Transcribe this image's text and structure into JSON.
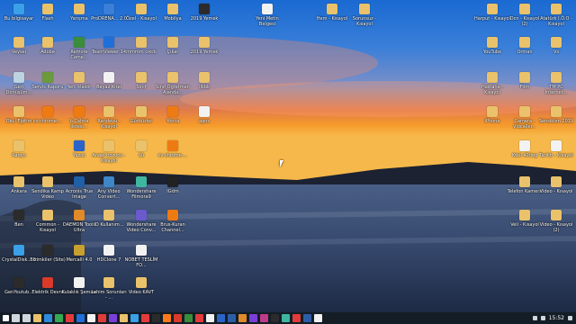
{
  "desktop": {
    "icons": [
      {
        "label": "Bu bilgisayar",
        "color": "#3aa0e8"
      },
      {
        "label": "Flash",
        "color": "#e9c26b"
      },
      {
        "label": "Yarışma",
        "color": "#e9c26b"
      },
      {
        "label": "ProDRENA... 2.0",
        "color": "#3b7fd9"
      },
      {
        "label": "Özel - Kısayol",
        "color": "#e9c26b"
      },
      {
        "label": "Mobilya",
        "color": "#e9c26b"
      },
      {
        "label": "2019 Yemek",
        "color": "#2b2b2b"
      },
      {
        "label": "Yeni Metin Belgesi",
        "color": "#f2f2f2"
      },
      {
        "label": "Hem - Kısayol",
        "color": "#e9c26b"
      },
      {
        "label": "Sorunsuz - Kısayol",
        "color": "#e9c26b"
      },
      {
        "label": "Harput - Kısayol",
        "color": "#e9c26b"
      },
      {
        "label": "Dcn - Kısayol (2)",
        "color": "#e9c26b"
      },
      {
        "label": "Atatürk İ.Ö.O - Kısayol",
        "color": "#e9c26b"
      },
      {
        "label": "Veysel",
        "color": "#e9c26b"
      },
      {
        "label": "Adobe",
        "color": "#e9c26b"
      },
      {
        "label": "Remote Came...",
        "color": "#3a8d3a"
      },
      {
        "label": "TeamViewer 14",
        "color": "#1e6fd9"
      },
      {
        "label": "mmmm cıkck",
        "color": "#e9c26b"
      },
      {
        "label": "Çıkar",
        "color": "#e9c26b"
      },
      {
        "label": "2019 Yemek",
        "color": "#e9c26b"
      },
      {
        "label": "YouTube",
        "color": "#e9c26b"
      },
      {
        "label": "Orman",
        "color": "#e9c26b"
      },
      {
        "label": "Vs",
        "color": "#e9c26b"
      },
      {
        "label": "Geri Dönüşüm...",
        "color": "#bcd3e0"
      },
      {
        "label": "Servis Raporu",
        "color": "#6a9a3a"
      },
      {
        "label": "Yeni klasör",
        "color": "#e9c26b"
      },
      {
        "label": "Beyaz Kitel",
        "color": "#f2f2f2"
      },
      {
        "label": "Sınıf",
        "color": "#e9c26b"
      },
      {
        "label": "Sınıf Öğretmen Ajanda...",
        "color": "#e9c26b"
      },
      {
        "label": "İlkbk",
        "color": "#e9c26b"
      },
      {
        "label": "Hastane - Kısayol",
        "color": "#e9c26b"
      },
      {
        "label": "Film",
        "color": "#e9c26b"
      },
      {
        "label": "TM PC İnternet...",
        "color": "#e9c26b"
      },
      {
        "label": "Okul Eğitim",
        "color": "#e9c26b"
      },
      {
        "label": "cv-chrome-...",
        "color": "#ee7a12"
      },
      {
        "label": "ö Çalma listesi...",
        "color": "#ee7a12"
      },
      {
        "label": "Randevu - Kısayol",
        "color": "#e9c26b"
      },
      {
        "label": "Gürbüzler",
        "color": "#e9c26b"
      },
      {
        "label": "Yonca",
        "color": "#ee7a12"
      },
      {
        "label": "agos",
        "color": "#f2f2f2"
      },
      {
        "label": "iPhone",
        "color": "#e9c26b"
      },
      {
        "label": "Camera - Vidcaller...",
        "color": "#e9c26b"
      },
      {
        "label": "Sensiklen 2019",
        "color": "#e9c26b"
      },
      {
        "label": "Radyo",
        "color": "#e9c26b"
      },
      {
        "label": "Yazıcı",
        "color": "#2a64c8"
      },
      {
        "label": "Anael bozucu - Kısayol",
        "color": "#e9c26b"
      },
      {
        "label": "Sü",
        "color": "#e9c26b"
      },
      {
        "label": "cv-chrome-...",
        "color": "#ee7a12"
      },
      {
        "label": "Kdel 40deg",
        "color": "#f2f2f2"
      },
      {
        "label": "Tarikb - Kısayol",
        "color": "#f2f2f2"
      },
      {
        "label": "Ankara",
        "color": "#e9c26b"
      },
      {
        "label": "Sendika Kamp Video",
        "color": "#e9c26b"
      },
      {
        "label": "Acronis True Image",
        "color": "#1f5fa8"
      },
      {
        "label": "Any Video Convert...",
        "color": "#3e86c9"
      },
      {
        "label": "Wondershare Filmora9",
        "color": "#3fb6a0"
      },
      {
        "label": "IGdm",
        "color": "#222222"
      },
      {
        "label": "Telefon Kamera",
        "color": "#e9c26b"
      },
      {
        "label": "Video - Kısayol",
        "color": "#e9c26b"
      },
      {
        "label": "Ben",
        "color": "#2b2b2b"
      },
      {
        "label": "Common - Kısayol",
        "color": "#e9c26b"
      },
      {
        "label": "DAEMON Tools Ultra",
        "color": "#e08a2a"
      },
      {
        "label": "ID Kullanım...",
        "color": "#e9c26b"
      },
      {
        "label": "Wondershare Video Conv...",
        "color": "#6a5acd"
      },
      {
        "label": "Brus-Kuran Channel...",
        "color": "#ee7a12"
      },
      {
        "label": "Veli - Kısayol",
        "color": "#e9c26b"
      },
      {
        "label": "Video - Kısayol (2)",
        "color": "#e9c26b"
      },
      {
        "label": "CrystalDisk... 8",
        "color": "#3aa0e8"
      },
      {
        "label": "Bizimkiler (Site)",
        "color": "#2b2b2b"
      },
      {
        "label": "Mercalli 4.0",
        "color": "#c8a030"
      },
      {
        "label": "HDClone 7",
        "color": "#f2f2f2"
      },
      {
        "label": "NOBET TESLİM FO...",
        "color": "#f2f2f2"
      },
      {
        "label": "GenYoutub...",
        "color": "#2b2b2b"
      },
      {
        "label": "Elektrik Devre",
        "color": "#d93a2a"
      },
      {
        "label": "Kulaklık Şeması",
        "color": "#f2f2f2"
      },
      {
        "label": "Lehim Sorunları - ...",
        "color": "#e9c26b"
      },
      {
        "label": "Video KAVT",
        "color": "#e9c26b"
      }
    ]
  },
  "taskbar": {
    "apps": [
      {
        "name": "start",
        "color": "#ffffff"
      },
      {
        "name": "search",
        "color": "#cfd6dd"
      },
      {
        "name": "task-view",
        "color": "#cfd6dd"
      },
      {
        "name": "file-explorer",
        "color": "#e9c26b"
      },
      {
        "name": "edge",
        "color": "#2f8ad9"
      },
      {
        "name": "chrome",
        "color": "#34a853"
      },
      {
        "name": "media",
        "color": "#e23b3b"
      },
      {
        "name": "app",
        "color": "#1e6fd9"
      },
      {
        "name": "app",
        "color": "#f2f2f2"
      },
      {
        "name": "app",
        "color": "#e23b3b"
      },
      {
        "name": "app",
        "color": "#7a3fd9"
      },
      {
        "name": "app",
        "color": "#e9c26b"
      },
      {
        "name": "app",
        "color": "#3aa0e8"
      },
      {
        "name": "app",
        "color": "#e23b3b"
      },
      {
        "name": "app",
        "color": "#2b2b2b"
      },
      {
        "name": "firefox",
        "color": "#ff7a1a"
      },
      {
        "name": "app",
        "color": "#d93a2a"
      },
      {
        "name": "app",
        "color": "#3a8d3a"
      },
      {
        "name": "app",
        "color": "#e23b3b"
      },
      {
        "name": "app",
        "color": "#f2f2f2"
      },
      {
        "name": "app",
        "color": "#2a64c8"
      },
      {
        "name": "photoshop",
        "color": "#2c5ea8"
      },
      {
        "name": "app",
        "color": "#e08a2a"
      },
      {
        "name": "app",
        "color": "#7a3fd9"
      },
      {
        "name": "app",
        "color": "#c03a8a"
      },
      {
        "name": "app",
        "color": "#2b2b2b"
      },
      {
        "name": "app",
        "color": "#3fb6a0"
      },
      {
        "name": "app",
        "color": "#e23b3b"
      },
      {
        "name": "app",
        "color": "#2c5ea8"
      },
      {
        "name": "app",
        "color": "#f2f2f2"
      }
    ],
    "clock": "15:52"
  },
  "colors": {
    "taskbar_bg": "#141d26"
  }
}
